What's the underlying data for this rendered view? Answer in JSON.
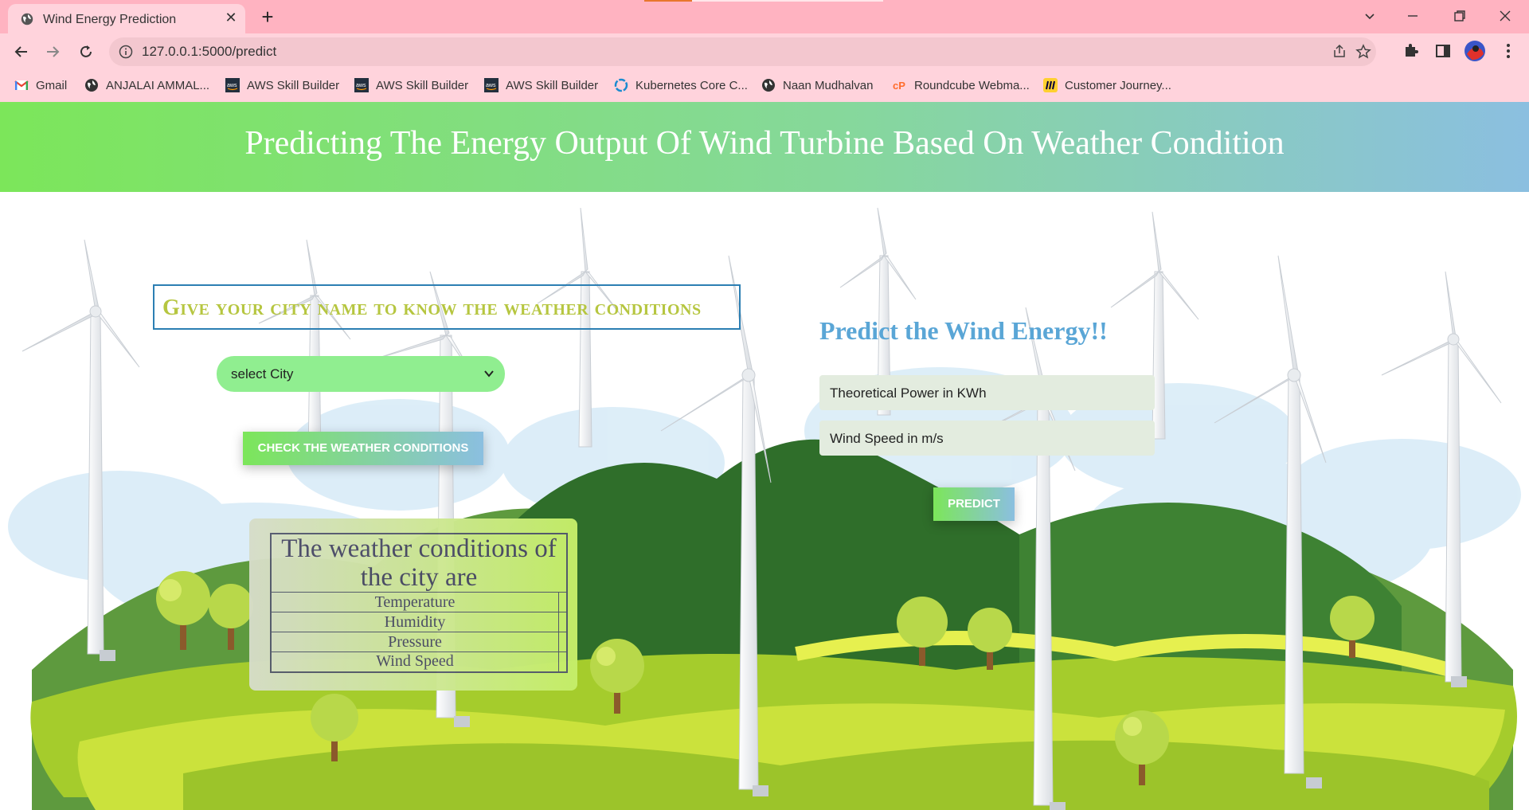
{
  "browser": {
    "tab_title": "Wind Energy Prediction",
    "url": "127.0.0.1:5000/predict",
    "bookmarks": [
      {
        "label": "Gmail",
        "icon": "gmail-icon"
      },
      {
        "label": "ANJALAI AMMAL...",
        "icon": "globe-icon"
      },
      {
        "label": "AWS Skill Builder",
        "icon": "aws-icon"
      },
      {
        "label": "AWS Skill Builder",
        "icon": "aws-icon"
      },
      {
        "label": "AWS Skill Builder",
        "icon": "aws-icon"
      },
      {
        "label": "Kubernetes Core C...",
        "icon": "kubernetes-icon"
      },
      {
        "label": "Naan Mudhalvan",
        "icon": "globe-icon"
      },
      {
        "label": "Roundcube Webma...",
        "icon": "cpanel-icon"
      },
      {
        "label": "Customer Journey...",
        "icon": "miro-icon"
      }
    ],
    "colors": {
      "tabbar": "#ffb3c1",
      "toolbar": "#ffd3dc"
    }
  },
  "page": {
    "title": "Predicting The Energy Output Of Wind Turbine Based On Weather Condition",
    "weather_section": {
      "heading": "Give your city name to know the weather conditions",
      "city_select": {
        "selected": "select City"
      },
      "check_button": "CHECK THE WEATHER CONDITIONS",
      "table": {
        "caption": "The weather conditions of the city are",
        "rows": [
          {
            "label": "Temperature",
            "value": ""
          },
          {
            "label": "Humidity",
            "value": ""
          },
          {
            "label": "Pressure",
            "value": ""
          },
          {
            "label": "Wind Speed",
            "value": ""
          }
        ]
      }
    },
    "prediction_section": {
      "heading": "Predict the Wind Energy!!",
      "theoretical_power_placeholder": "Theoretical Power in KWh",
      "wind_speed_placeholder": "Wind Speed in m/s",
      "predict_button": "PREDICT"
    },
    "colors": {
      "header_gradient_start": "#7ce65a",
      "header_gradient_end": "#8bbfe0",
      "city_heading": "#b6c640",
      "predict_heading": "#5aa6d6",
      "select_bg": "#90ee90"
    }
  }
}
